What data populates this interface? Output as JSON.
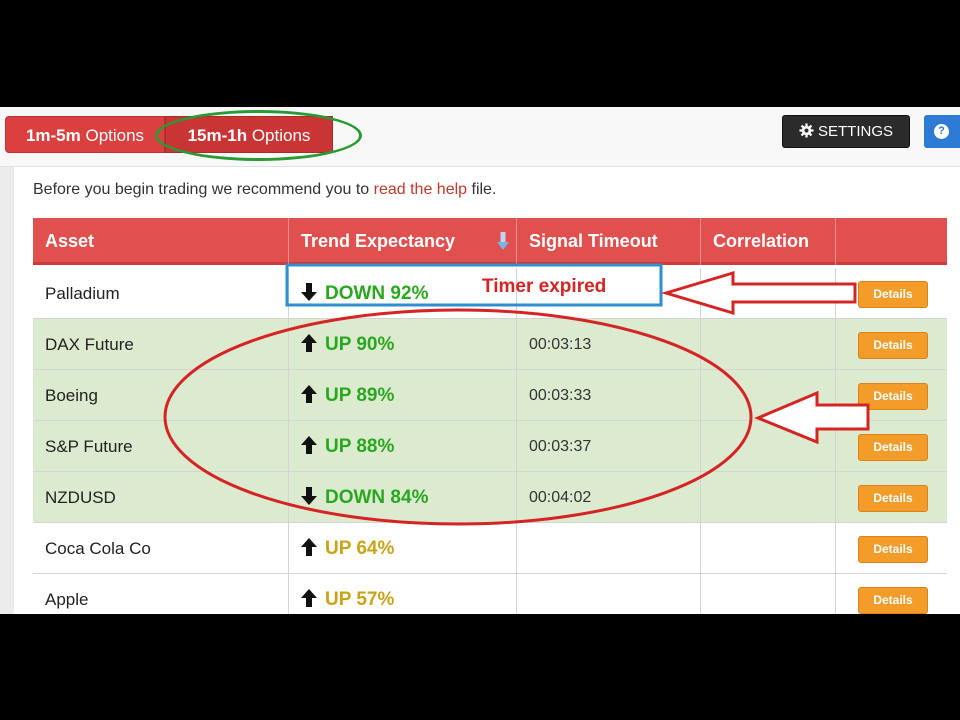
{
  "tabs": [
    {
      "label_bold": "1m-5m",
      "label_rest": " Options"
    },
    {
      "label_bold": "15m-1h",
      "label_rest": " Options"
    }
  ],
  "settings_label": "SETTINGS",
  "help_label": "?",
  "intro": {
    "before": "Before you begin trading we recommend you to ",
    "link": "read the help",
    "after": " file."
  },
  "table": {
    "headers": [
      "Asset",
      "Trend Expectancy",
      "Signal Timeout",
      "Correlation"
    ],
    "rows": [
      {
        "asset": "Palladium",
        "trend": "DOWN 92%",
        "direction": "down",
        "timeout": "",
        "highlight": false
      },
      {
        "asset": "DAX Future",
        "trend": "UP 90%",
        "direction": "up",
        "timeout": "00:03:13",
        "highlight": true
      },
      {
        "asset": "Boeing",
        "trend": "UP 89%",
        "direction": "up",
        "timeout": "00:03:33",
        "highlight": true
      },
      {
        "asset": "S&P Future",
        "trend": "UP 88%",
        "direction": "up",
        "timeout": "00:03:37",
        "highlight": true
      },
      {
        "asset": "NZDUSD",
        "trend": "DOWN 84%",
        "direction": "down",
        "timeout": "00:04:02",
        "highlight": true
      },
      {
        "asset": "Coca Cola Co",
        "trend": "UP 64%",
        "direction": "up",
        "timeout": "",
        "highlight": false
      },
      {
        "asset": "Apple",
        "trend": "UP 57%",
        "direction": "up",
        "timeout": "",
        "highlight": false
      }
    ],
    "details_label": "Details"
  },
  "annotation": {
    "timer_text": "Timer expired"
  },
  "colors": {
    "accent_red": "#d9403f",
    "highlight_row": "#dcebd0",
    "details_orange": "#f39c2a",
    "trend_green": "#29a81f",
    "trend_gold": "#c9a417",
    "annotation_red": "#d42424",
    "annotation_green": "#2a9a34",
    "annotation_blue": "#2f8fd0"
  }
}
